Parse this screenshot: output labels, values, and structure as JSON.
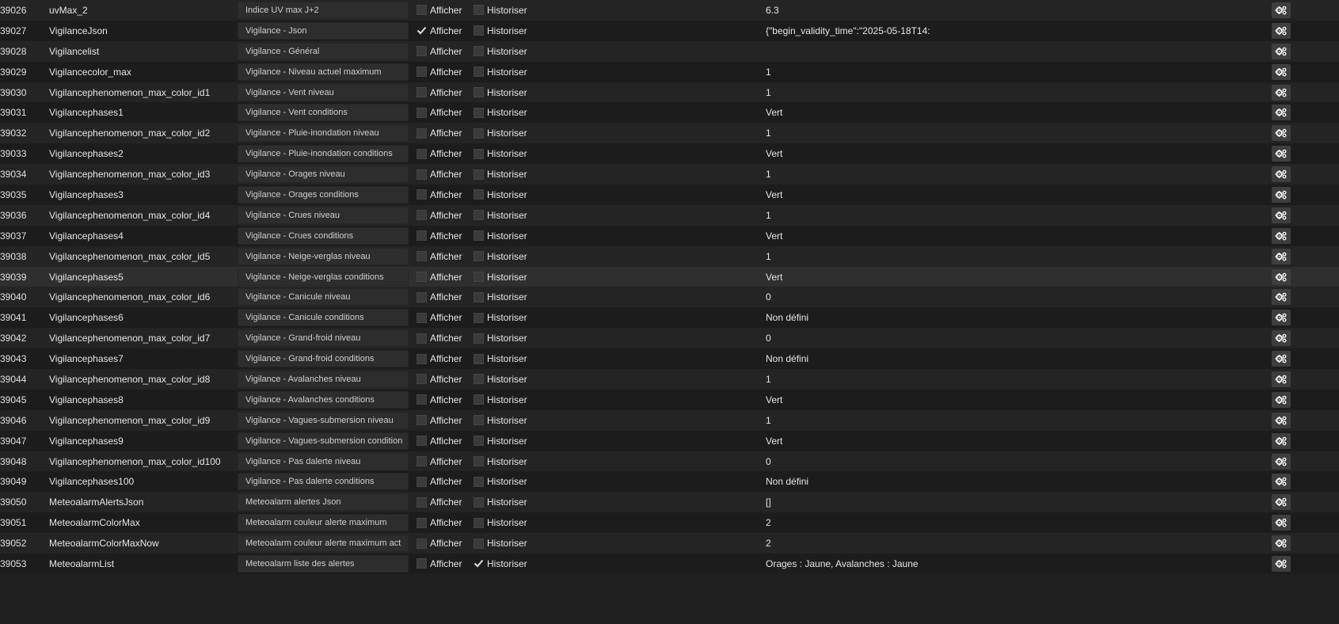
{
  "labels": {
    "afficher": "Afficher",
    "historiser": "Historiser"
  },
  "rows": [
    {
      "id": "39026",
      "name": "uvMax_2",
      "desc": "Indice UV max J+2",
      "afficher": false,
      "historiser": false,
      "value": "6.3"
    },
    {
      "id": "39027",
      "name": "VigilanceJson",
      "desc": "Vigilance - Json",
      "afficher": true,
      "historiser": false,
      "value": "{\"begin_validity_time\":\"2025-05-18T14:"
    },
    {
      "id": "39028",
      "name": "Vigilancelist",
      "desc": "Vigilance - Général",
      "afficher": false,
      "historiser": false,
      "value": ""
    },
    {
      "id": "39029",
      "name": "Vigilancecolor_max",
      "desc": "Vigilance - Niveau actuel maximum",
      "afficher": false,
      "historiser": false,
      "value": "1"
    },
    {
      "id": "39030",
      "name": "Vigilancephenomenon_max_color_id1",
      "desc": "Vigilance - Vent niveau",
      "afficher": false,
      "historiser": false,
      "value": "1"
    },
    {
      "id": "39031",
      "name": "Vigilancephases1",
      "desc": "Vigilance - Vent conditions",
      "afficher": false,
      "historiser": false,
      "value": "Vert"
    },
    {
      "id": "39032",
      "name": "Vigilancephenomenon_max_color_id2",
      "desc": "Vigilance - Pluie-inondation niveau",
      "afficher": false,
      "historiser": false,
      "value": "1"
    },
    {
      "id": "39033",
      "name": "Vigilancephases2",
      "desc": "Vigilance - Pluie-inondation conditions",
      "afficher": false,
      "historiser": false,
      "value": "Vert"
    },
    {
      "id": "39034",
      "name": "Vigilancephenomenon_max_color_id3",
      "desc": "Vigilance - Orages niveau",
      "afficher": false,
      "historiser": false,
      "value": "1"
    },
    {
      "id": "39035",
      "name": "Vigilancephases3",
      "desc": "Vigilance - Orages conditions",
      "afficher": false,
      "historiser": false,
      "value": "Vert"
    },
    {
      "id": "39036",
      "name": "Vigilancephenomenon_max_color_id4",
      "desc": "Vigilance - Crues niveau",
      "afficher": false,
      "historiser": false,
      "value": "1"
    },
    {
      "id": "39037",
      "name": "Vigilancephases4",
      "desc": "Vigilance - Crues conditions",
      "afficher": false,
      "historiser": false,
      "value": "Vert"
    },
    {
      "id": "39038",
      "name": "Vigilancephenomenon_max_color_id5",
      "desc": "Vigilance - Neige-verglas niveau",
      "afficher": false,
      "historiser": false,
      "value": "1"
    },
    {
      "id": "39039",
      "name": "Vigilancephases5",
      "desc": "Vigilance - Neige-verglas conditions",
      "afficher": false,
      "historiser": false,
      "value": "Vert"
    },
    {
      "id": "39040",
      "name": "Vigilancephenomenon_max_color_id6",
      "desc": "Vigilance - Canicule niveau",
      "afficher": false,
      "historiser": false,
      "value": "0"
    },
    {
      "id": "39041",
      "name": "Vigilancephases6",
      "desc": "Vigilance - Canicule conditions",
      "afficher": false,
      "historiser": false,
      "value": "Non défini"
    },
    {
      "id": "39042",
      "name": "Vigilancephenomenon_max_color_id7",
      "desc": "Vigilance - Grand-froid niveau",
      "afficher": false,
      "historiser": false,
      "value": "0"
    },
    {
      "id": "39043",
      "name": "Vigilancephases7",
      "desc": "Vigilance - Grand-froid conditions",
      "afficher": false,
      "historiser": false,
      "value": "Non défini"
    },
    {
      "id": "39044",
      "name": "Vigilancephenomenon_max_color_id8",
      "desc": "Vigilance - Avalanches niveau",
      "afficher": false,
      "historiser": false,
      "value": "1"
    },
    {
      "id": "39045",
      "name": "Vigilancephases8",
      "desc": "Vigilance - Avalanches conditions",
      "afficher": false,
      "historiser": false,
      "value": "Vert"
    },
    {
      "id": "39046",
      "name": "Vigilancephenomenon_max_color_id9",
      "desc": "Vigilance - Vagues-submersion niveau",
      "afficher": false,
      "historiser": false,
      "value": "1"
    },
    {
      "id": "39047",
      "name": "Vigilancephases9",
      "desc": "Vigilance - Vagues-submersion condition",
      "afficher": false,
      "historiser": false,
      "value": "Vert"
    },
    {
      "id": "39048",
      "name": "Vigilancephenomenon_max_color_id100",
      "desc": "Vigilance - Pas dalerte niveau",
      "afficher": false,
      "historiser": false,
      "value": "0"
    },
    {
      "id": "39049",
      "name": "Vigilancephases100",
      "desc": "Vigilance - Pas dalerte conditions",
      "afficher": false,
      "historiser": false,
      "value": "Non défini"
    },
    {
      "id": "39050",
      "name": "MeteoalarmAlertsJson",
      "desc": "Meteoalarm alertes Json",
      "afficher": false,
      "historiser": false,
      "value": "[]"
    },
    {
      "id": "39051",
      "name": "MeteoalarmColorMax",
      "desc": "Meteoalarm couleur alerte maximum",
      "afficher": false,
      "historiser": false,
      "value": "2"
    },
    {
      "id": "39052",
      "name": "MeteoalarmColorMaxNow",
      "desc": "Meteoalarm couleur alerte maximum act",
      "afficher": false,
      "historiser": false,
      "value": "2"
    },
    {
      "id": "39053",
      "name": "MeteoalarmList",
      "desc": "Meteoalarm liste des alertes",
      "afficher": false,
      "historiser": true,
      "value": "Orages : Jaune, Avalanches : Jaune"
    }
  ],
  "hover_row_index": 13,
  "icons": {
    "checkmark": "check-icon",
    "configure": "cogs-icon"
  }
}
